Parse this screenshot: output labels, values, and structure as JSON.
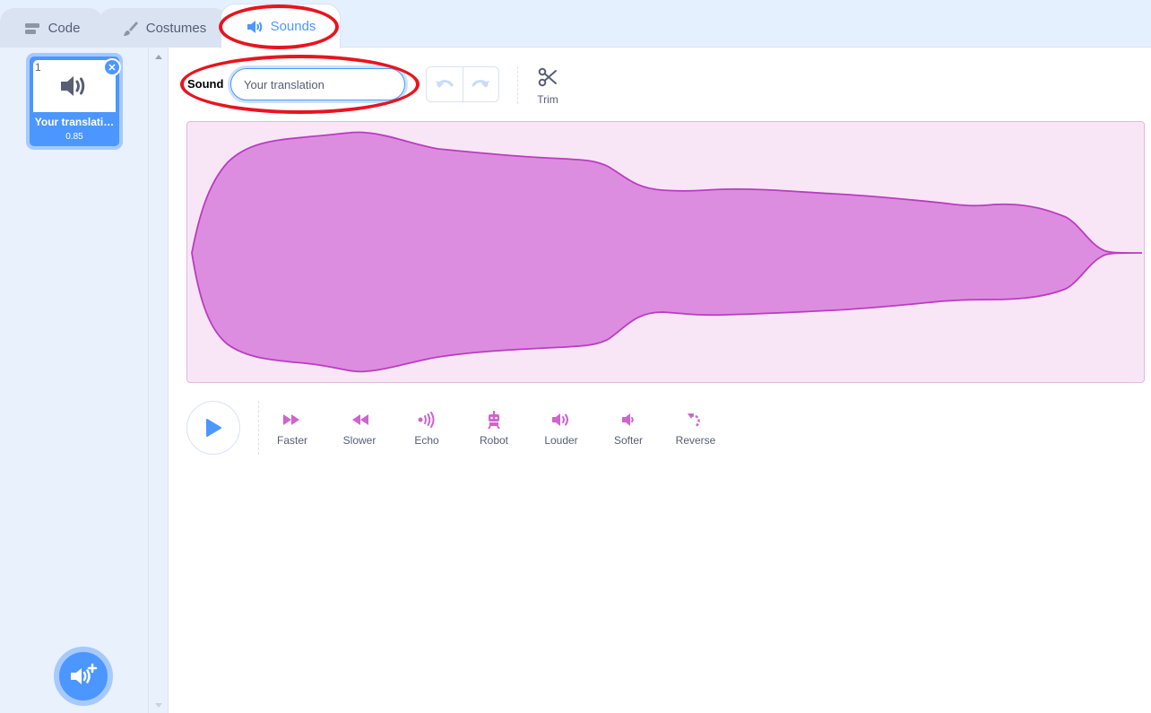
{
  "tabs": {
    "code": "Code",
    "costumes": "Costumes",
    "sounds": "Sounds"
  },
  "sound_list": {
    "items": [
      {
        "index": "1",
        "name": "Your translati…",
        "duration": "0.85"
      }
    ]
  },
  "editor": {
    "sound_label": "Sound",
    "sound_name": "Your translation",
    "trim_label": "Trim",
    "effects": [
      {
        "label": "Faster",
        "icon": "faster-icon"
      },
      {
        "label": "Slower",
        "icon": "slower-icon"
      },
      {
        "label": "Echo",
        "icon": "echo-icon"
      },
      {
        "label": "Robot",
        "icon": "robot-icon"
      },
      {
        "label": "Louder",
        "icon": "louder-icon"
      },
      {
        "label": "Softer",
        "icon": "softer-icon"
      },
      {
        "label": "Reverse",
        "icon": "reverse-icon"
      }
    ]
  },
  "colors": {
    "accent": "#4c97ff",
    "waveform_fill": "#dd8de0",
    "waveform_stroke": "#bb3cc1",
    "effect_icon": "#cf63cf",
    "annotation": "#e8141f"
  }
}
